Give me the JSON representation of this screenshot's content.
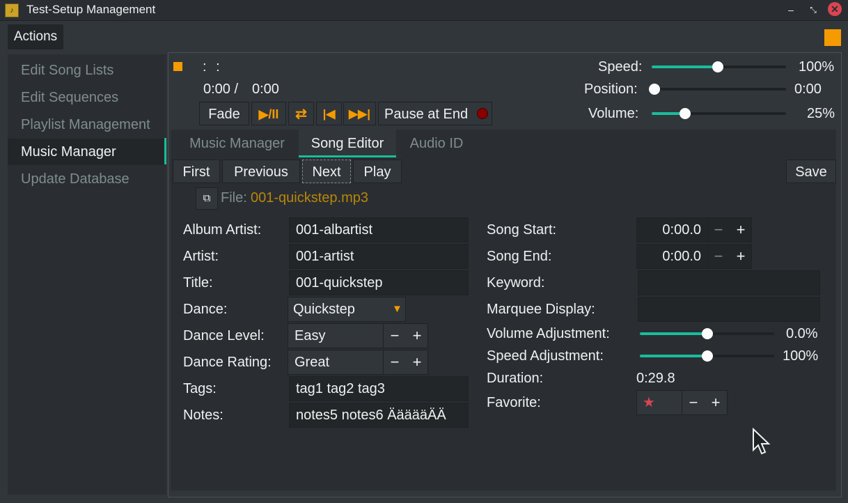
{
  "window": {
    "title": "Test-Setup Management",
    "minimize": "–",
    "restore": "⤡",
    "close": "✕"
  },
  "menu": {
    "actions": "Actions"
  },
  "sidebar": {
    "items": [
      {
        "label": "Edit Song Lists"
      },
      {
        "label": "Edit Sequences"
      },
      {
        "label": "Playlist Management"
      },
      {
        "label": "Music Manager"
      },
      {
        "label": "Update Database"
      }
    ]
  },
  "player": {
    "song_title": ": :",
    "elapsed": "0:00 /",
    "total": "0:00",
    "fade_label": "Fade",
    "play_pause_icon": "▶/II",
    "loop_icon": "⇄",
    "prev_icon": "|◀",
    "next_icon": "▶▶|",
    "pause_at_end_label": "Pause at End",
    "speed_label": "Speed:",
    "speed_value": "100%",
    "speed_level": 0.49,
    "position_label": "Position:",
    "position_value": "0:00",
    "position_level": 0.0,
    "volume_label": "Volume:",
    "volume_value": "25%",
    "volume_level": 0.25
  },
  "tabs": [
    {
      "label": "Music Manager"
    },
    {
      "label": "Song Editor"
    },
    {
      "label": "Audio ID"
    }
  ],
  "editor": {
    "first": "First",
    "previous": "Previous",
    "next": "Next",
    "play": "Play",
    "save": "Save",
    "file_label": "File:",
    "file_name": "001-quickstep.mp3",
    "album_artist_label": "Album Artist:",
    "album_artist": "001-albartist",
    "artist_label": "Artist:",
    "artist": "001-artist",
    "title_label": "Title:",
    "title": "001-quickstep",
    "dance_label": "Dance:",
    "dance": "Quickstep",
    "dance_level_label": "Dance Level:",
    "dance_level": "Easy",
    "dance_rating_label": "Dance Rating:",
    "dance_rating": "Great",
    "tags_label": "Tags:",
    "tags": "tag1 tag2 tag3",
    "notes_label": "Notes:",
    "notes": "notes5 notes6  ÄääääÄÄ",
    "song_start_label": "Song Start:",
    "song_start": "0:00.0",
    "song_end_label": "Song End:",
    "song_end": "0:00.0",
    "keyword_label": "Keyword:",
    "keyword": "",
    "marquee_label": "Marquee Display:",
    "marquee": "",
    "volume_adj_label": "Volume Adjustment:",
    "volume_adj": "0.0%",
    "volume_adj_level": 0.5,
    "speed_adj_label": "Speed Adjustment:",
    "speed_adj": "100%",
    "speed_adj_level": 0.5,
    "duration_label": "Duration:",
    "duration": "0:29.8",
    "favorite_label": "Favorite:",
    "favorite_star": "★",
    "minus": "−",
    "plus": "+"
  },
  "colors": {
    "accent": "#f59a00",
    "slider": "#1abc9c",
    "active_tab": "#1abc9c",
    "star": "#da4453"
  }
}
